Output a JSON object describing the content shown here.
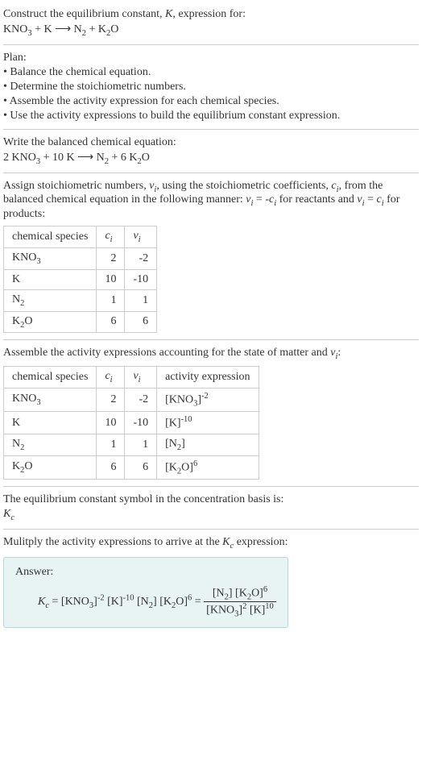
{
  "prompt": {
    "line1": "Construct the equilibrium constant, K, expression for:",
    "eq": "KNO₃ + K ⟶ N₂ + K₂O"
  },
  "plan": {
    "heading": "Plan:",
    "items": [
      "• Balance the chemical equation.",
      "• Determine the stoichiometric numbers.",
      "• Assemble the activity expression for each chemical species.",
      "• Use the activity expressions to build the equilibrium constant expression."
    ]
  },
  "balanced": {
    "heading": "Write the balanced chemical equation:",
    "eq": "2 KNO₃ + 10 K ⟶ N₂ + 6 K₂O"
  },
  "assign": {
    "text": "Assign stoichiometric numbers, νᵢ, using the stoichiometric coefficients, cᵢ, from the balanced chemical equation in the following manner: νᵢ = -cᵢ for reactants and νᵢ = cᵢ for products:"
  },
  "table1": {
    "headers": [
      "chemical species",
      "cᵢ",
      "νᵢ"
    ],
    "rows": [
      [
        "KNO₃",
        "2",
        "-2"
      ],
      [
        "K",
        "10",
        "-10"
      ],
      [
        "N₂",
        "1",
        "1"
      ],
      [
        "K₂O",
        "6",
        "6"
      ]
    ]
  },
  "assemble": {
    "text": "Assemble the activity expressions accounting for the state of matter and νᵢ:"
  },
  "table2": {
    "headers": [
      "chemical species",
      "cᵢ",
      "νᵢ",
      "activity expression"
    ],
    "rows": [
      {
        "sp": "KNO₃",
        "c": "2",
        "v": "-2",
        "ae_base": "[KNO₃]",
        "ae_exp": "-2"
      },
      {
        "sp": "K",
        "c": "10",
        "v": "-10",
        "ae_base": "[K]",
        "ae_exp": "-10"
      },
      {
        "sp": "N₂",
        "c": "1",
        "v": "1",
        "ae_base": "[N₂]",
        "ae_exp": ""
      },
      {
        "sp": "K₂O",
        "c": "6",
        "v": "6",
        "ae_base": "[K₂O]",
        "ae_exp": "6"
      }
    ]
  },
  "symbol": {
    "line1": "The equilibrium constant symbol in the concentration basis is:",
    "line2": "K_c"
  },
  "multiply": {
    "text": "Mulitply the activity expressions to arrive at the K_c expression:"
  },
  "answer": {
    "label": "Answer:",
    "lhs": "K_c =",
    "term1_base": "[KNO₃]",
    "term1_exp": "-2",
    "term2_base": "[K]",
    "term2_exp": "-10",
    "term3_base": "[N₂]",
    "term3_exp": "",
    "term4_base": "[K₂O]",
    "term4_exp": "6",
    "frac_num_a": "[N₂]",
    "frac_num_b_base": "[K₂O]",
    "frac_num_b_exp": "6",
    "frac_den_a_base": "[KNO₃]",
    "frac_den_a_exp": "2",
    "frac_den_b_base": "[K]",
    "frac_den_b_exp": "10"
  },
  "chart_data": {
    "type": "table",
    "tables": [
      {
        "title": "stoichiometric numbers",
        "headers": [
          "chemical species",
          "c_i",
          "nu_i"
        ],
        "rows": [
          [
            "KNO3",
            2,
            -2
          ],
          [
            "K",
            10,
            -10
          ],
          [
            "N2",
            1,
            1
          ],
          [
            "K2O",
            6,
            6
          ]
        ]
      },
      {
        "title": "activity expressions",
        "headers": [
          "chemical species",
          "c_i",
          "nu_i",
          "activity expression"
        ],
        "rows": [
          [
            "KNO3",
            2,
            -2,
            "[KNO3]^-2"
          ],
          [
            "K",
            10,
            -10,
            "[K]^-10"
          ],
          [
            "N2",
            1,
            1,
            "[N2]"
          ],
          [
            "K2O",
            6,
            6,
            "[K2O]^6"
          ]
        ]
      }
    ]
  }
}
